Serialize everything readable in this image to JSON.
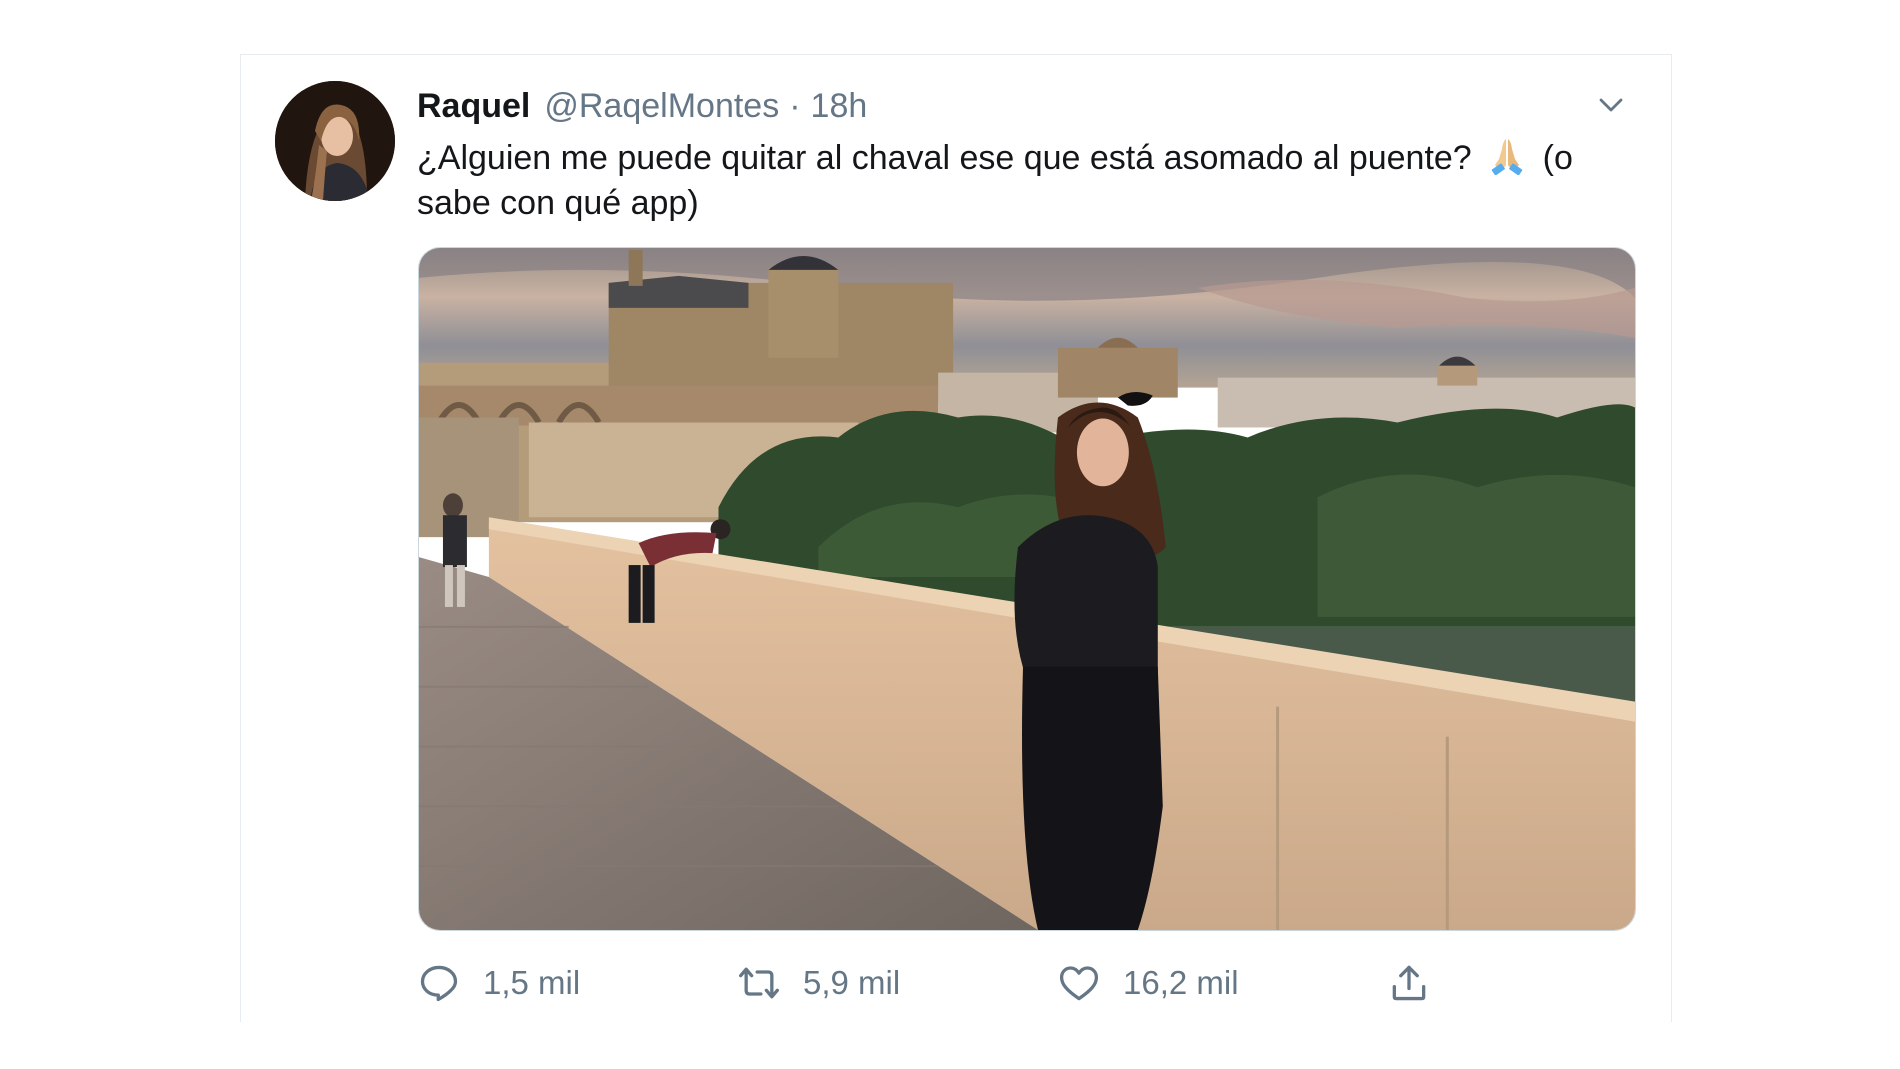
{
  "tweet": {
    "display_name": "Raquel",
    "handle": "@RaqelMontes",
    "separator": "·",
    "time": "18h",
    "text_before_emoji": "¿Alguien me puede quitar al chaval ese que está asomado al puente?",
    "emoji_icon": "folded-hands-icon",
    "text_after_emoji": "(o sabe con qué app)"
  },
  "actions": {
    "reply_count": "1,5 mil",
    "retweet_count": "5,9 mil",
    "like_count": "16,2 mil"
  },
  "icons": {
    "caret": "chevron-down-icon",
    "reply": "speech-bubble-icon",
    "retweet": "retweet-icon",
    "like": "heart-icon",
    "share": "share-icon"
  },
  "colors": {
    "text_primary": "#14171a",
    "text_secondary": "#657786",
    "border": "#e6ecf0"
  }
}
